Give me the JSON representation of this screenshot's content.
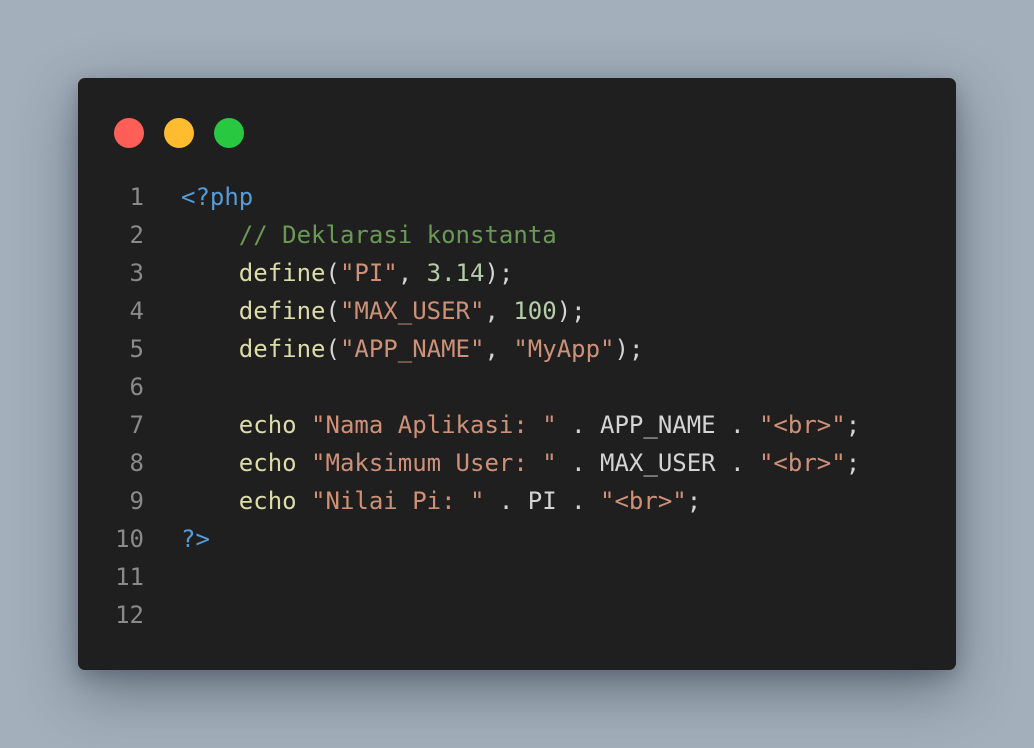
{
  "window": {
    "traffic_lights": [
      {
        "name": "close",
        "color": "#ff5f57"
      },
      {
        "name": "minimize",
        "color": "#febc2e"
      },
      {
        "name": "zoom",
        "color": "#28c840"
      }
    ]
  },
  "colors": {
    "tag": "#569cd6",
    "comment": "#6a9955",
    "function": "#dcdcaa",
    "string": "#ce9178",
    "number": "#b5cea8",
    "plain": "#d4d4d4",
    "line_number": "#8a8a8a"
  },
  "code": {
    "language": "php",
    "lines": [
      {
        "number": "1",
        "tokens": [
          {
            "text": "<?php",
            "type": "tag"
          }
        ]
      },
      {
        "number": "2",
        "tokens": [
          {
            "text": "    ",
            "type": "plain"
          },
          {
            "text": "// Deklarasi konstanta",
            "type": "comment"
          }
        ]
      },
      {
        "number": "3",
        "tokens": [
          {
            "text": "    ",
            "type": "plain"
          },
          {
            "text": "define",
            "type": "function"
          },
          {
            "text": "(",
            "type": "plain"
          },
          {
            "text": "\"PI\"",
            "type": "string"
          },
          {
            "text": ", ",
            "type": "plain"
          },
          {
            "text": "3.14",
            "type": "number"
          },
          {
            "text": ");",
            "type": "plain"
          }
        ]
      },
      {
        "number": "4",
        "tokens": [
          {
            "text": "    ",
            "type": "plain"
          },
          {
            "text": "define",
            "type": "function"
          },
          {
            "text": "(",
            "type": "plain"
          },
          {
            "text": "\"MAX_USER\"",
            "type": "string"
          },
          {
            "text": ", ",
            "type": "plain"
          },
          {
            "text": "100",
            "type": "number"
          },
          {
            "text": ");",
            "type": "plain"
          }
        ]
      },
      {
        "number": "5",
        "tokens": [
          {
            "text": "    ",
            "type": "plain"
          },
          {
            "text": "define",
            "type": "function"
          },
          {
            "text": "(",
            "type": "plain"
          },
          {
            "text": "\"APP_NAME\"",
            "type": "string"
          },
          {
            "text": ", ",
            "type": "plain"
          },
          {
            "text": "\"MyApp\"",
            "type": "string"
          },
          {
            "text": ");",
            "type": "plain"
          }
        ]
      },
      {
        "number": "6",
        "tokens": []
      },
      {
        "number": "7",
        "tokens": [
          {
            "text": "    ",
            "type": "plain"
          },
          {
            "text": "echo",
            "type": "function"
          },
          {
            "text": " ",
            "type": "plain"
          },
          {
            "text": "\"Nama Aplikasi: \"",
            "type": "string"
          },
          {
            "text": " . APP_NAME . ",
            "type": "plain"
          },
          {
            "text": "\"<br>\"",
            "type": "string"
          },
          {
            "text": ";",
            "type": "plain"
          }
        ]
      },
      {
        "number": "8",
        "tokens": [
          {
            "text": "    ",
            "type": "plain"
          },
          {
            "text": "echo",
            "type": "function"
          },
          {
            "text": " ",
            "type": "plain"
          },
          {
            "text": "\"Maksimum User: \"",
            "type": "string"
          },
          {
            "text": " . MAX_USER . ",
            "type": "plain"
          },
          {
            "text": "\"<br>\"",
            "type": "string"
          },
          {
            "text": ";",
            "type": "plain"
          }
        ]
      },
      {
        "number": "9",
        "tokens": [
          {
            "text": "    ",
            "type": "plain"
          },
          {
            "text": "echo",
            "type": "function"
          },
          {
            "text": " ",
            "type": "plain"
          },
          {
            "text": "\"Nilai Pi: \"",
            "type": "string"
          },
          {
            "text": " . PI . ",
            "type": "plain"
          },
          {
            "text": "\"<br>\"",
            "type": "string"
          },
          {
            "text": ";",
            "type": "plain"
          }
        ]
      },
      {
        "number": "10",
        "tokens": [
          {
            "text": "?>",
            "type": "tag"
          }
        ]
      },
      {
        "number": "11",
        "tokens": []
      },
      {
        "number": "12",
        "tokens": []
      }
    ]
  }
}
